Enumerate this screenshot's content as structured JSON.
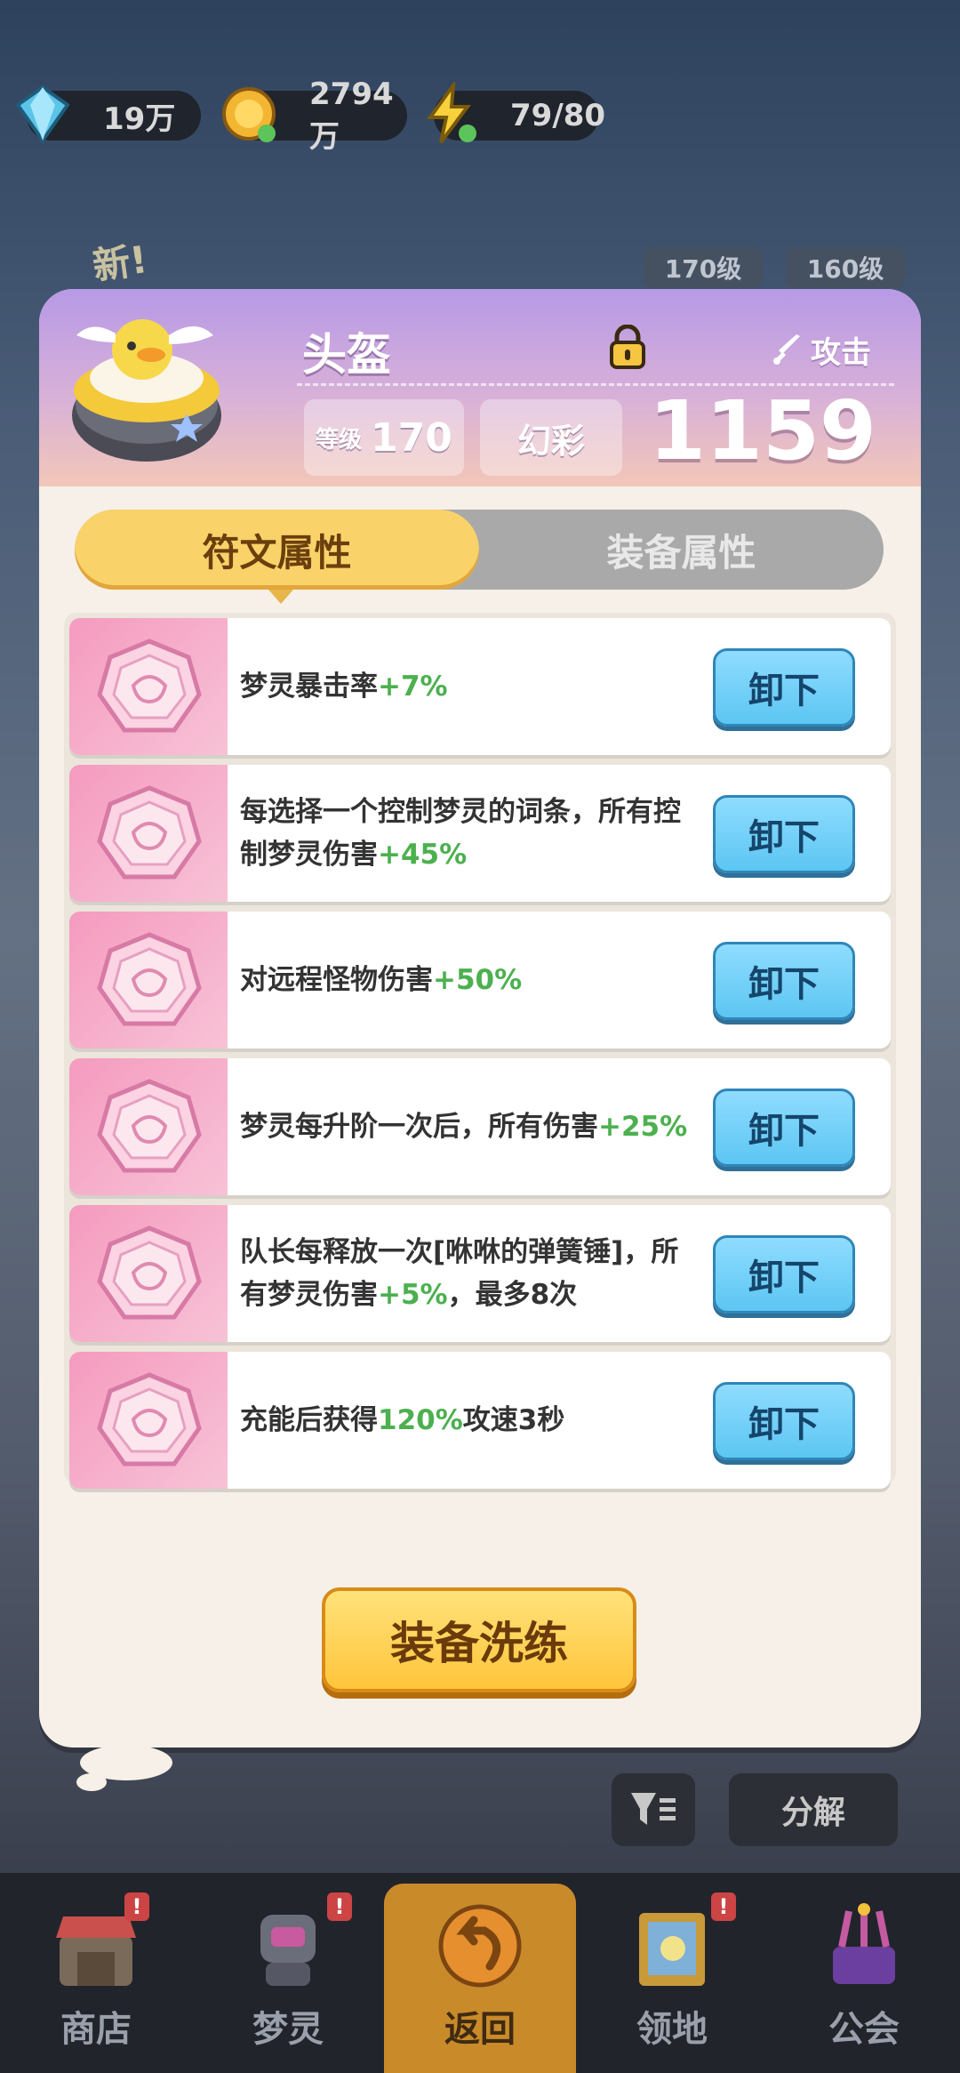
{
  "resources": [
    {
      "name": "diamond",
      "value": "19万"
    },
    {
      "name": "coin",
      "value": "2794万"
    },
    {
      "name": "energy",
      "value": "79/80"
    }
  ],
  "background": {
    "new_tag": "新!",
    "level_tags": [
      "170级",
      "160级"
    ]
  },
  "item": {
    "name": "头盔",
    "locked": true,
    "type_label": "攻击",
    "level_key": "等级",
    "level_value": "170",
    "rarity": "幻彩",
    "power": "1159"
  },
  "tabs": [
    {
      "label": "符文属性",
      "active": true
    },
    {
      "label": "装备属性",
      "active": false
    }
  ],
  "runes": [
    {
      "parts": [
        {
          "t": "梦灵暴击率",
          "g": false
        },
        {
          "t": "+7%",
          "g": true
        }
      ],
      "action": "卸下"
    },
    {
      "parts": [
        {
          "t": "每选择一个控制梦灵的词条，所有控制梦灵伤害",
          "g": false
        },
        {
          "t": "+45%",
          "g": true
        }
      ],
      "action": "卸下"
    },
    {
      "parts": [
        {
          "t": "对远程怪物伤害",
          "g": false
        },
        {
          "t": "+50%",
          "g": true
        }
      ],
      "action": "卸下"
    },
    {
      "parts": [
        {
          "t": "梦灵每升阶一次后，所有伤害",
          "g": false
        },
        {
          "t": "+25%",
          "g": true
        }
      ],
      "action": "卸下"
    },
    {
      "parts": [
        {
          "t": "队长每释放一次[咻咻的弹簧锤]，所有梦灵伤害",
          "g": false
        },
        {
          "t": "+5%",
          "g": true
        },
        {
          "t": "，最多8次",
          "g": false
        }
      ],
      "action": "卸下"
    },
    {
      "parts": [
        {
          "t": "充能后获得",
          "g": false
        },
        {
          "t": "120%",
          "g": true
        },
        {
          "t": "攻速3秒",
          "g": false
        }
      ],
      "action": "卸下"
    }
  ],
  "refine_label": "装备洗练",
  "decompose_label": "分解",
  "nav": [
    {
      "label": "商店",
      "badge": "!",
      "active": false
    },
    {
      "label": "梦灵",
      "badge": "!",
      "active": false
    },
    {
      "label": "返回",
      "badge": "",
      "active": true
    },
    {
      "label": "领地",
      "badge": "!",
      "active": false
    },
    {
      "label": "公会",
      "badge": "",
      "active": false
    }
  ],
  "colors": {
    "accent_green": "#4cb04f",
    "unequip_blue": "#5cc6f2",
    "refine_yellow": "#ffc53b",
    "tab_active": "#f9d36a"
  }
}
